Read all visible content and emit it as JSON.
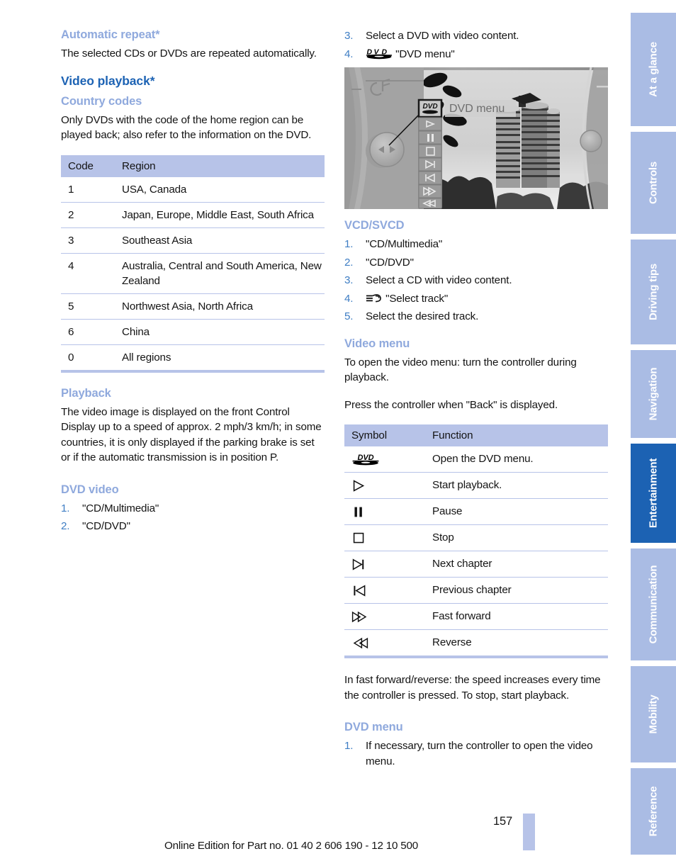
{
  "document": {
    "page_number": "157",
    "edition_notice": "Online Edition for Part no. 01 40 2 606 190 - 12 10 500"
  },
  "sidebar": {
    "tabs": [
      {
        "label": "At a glance",
        "active": false
      },
      {
        "label": "Controls",
        "active": false
      },
      {
        "label": "Driving tips",
        "active": false
      },
      {
        "label": "Navigation",
        "active": false
      },
      {
        "label": "Entertainment",
        "active": true
      },
      {
        "label": "Communication",
        "active": false
      },
      {
        "label": "Mobility",
        "active": false
      },
      {
        "label": "Reference",
        "active": false
      }
    ],
    "colors": {
      "inactive": "#aabce4",
      "active": "#1c62b3",
      "label": "#ffffff"
    }
  },
  "left_column": {
    "automatic_repeat": {
      "heading": "Automatic repeat*",
      "body": "The selected CDs or DVDs are repeated automatically."
    },
    "video_playback": {
      "heading": "Video playback*"
    },
    "country_codes": {
      "heading": "Country codes",
      "body": "Only DVDs with the code of the home region can be played back; also refer to the information on the DVD.",
      "table": {
        "headers": [
          "Code",
          "Region"
        ],
        "rows": [
          [
            "1",
            "USA, Canada"
          ],
          [
            "2",
            "Japan, Europe, Middle East, South Africa"
          ],
          [
            "3",
            "Southeast Asia"
          ],
          [
            "4",
            "Australia, Central and South America, New Zealand"
          ],
          [
            "5",
            "Northwest Asia, North Africa"
          ],
          [
            "6",
            "China"
          ],
          [
            "0",
            "All regions"
          ]
        ]
      }
    },
    "playback": {
      "heading": "Playback",
      "body": "The video image is displayed on the front Control Display up to a speed of approx. 2 mph/3 km/h; in some countries, it is only displayed if the parking brake is set or if the automatic transmission is in position P."
    },
    "dvd_video": {
      "heading": "DVD video",
      "steps": [
        {
          "num": "1.",
          "text": "\"CD/Multimedia\""
        },
        {
          "num": "2.",
          "text": "\"CD/DVD\""
        }
      ]
    }
  },
  "right_column": {
    "dvd_video_continued": {
      "steps": [
        {
          "num": "3.",
          "text": "Select a DVD with video content.",
          "icon": ""
        },
        {
          "num": "4.",
          "text": "\"DVD menu\"",
          "icon": "dvd-logo-icon"
        }
      ]
    },
    "figure": {
      "name": "control-display-dvd-menu-screenshot",
      "tooltip_label": "DVD menu",
      "menu_icons": [
        "dvd-logo-icon",
        "play-icon",
        "pause-icon",
        "stop-icon",
        "next-chapter-icon",
        "previous-chapter-icon",
        "fast-forward-icon",
        "reverse-icon"
      ],
      "top_left_icon": "audio-note-icon"
    },
    "vcd_svcd": {
      "heading": "VCD/SVCD",
      "steps": [
        {
          "num": "1.",
          "text": "\"CD/Multimedia\"",
          "icon": ""
        },
        {
          "num": "2.",
          "text": "\"CD/DVD\"",
          "icon": ""
        },
        {
          "num": "3.",
          "text": "Select a CD with video content.",
          "icon": ""
        },
        {
          "num": "4.",
          "text": "\"Select track\"",
          "icon": "select-track-icon"
        },
        {
          "num": "5.",
          "text": "Select the desired track.",
          "icon": ""
        }
      ]
    },
    "video_menu": {
      "heading": "Video menu",
      "body1": "To open the video menu: turn the controller during playback.",
      "body2": "Press the controller when \"Back\" is displayed.",
      "table": {
        "headers": [
          "Symbol",
          "Function"
        ],
        "rows": [
          {
            "icon": "dvd-logo-icon",
            "function": "Open the DVD menu."
          },
          {
            "icon": "play-icon",
            "function": "Start playback."
          },
          {
            "icon": "pause-icon",
            "function": "Pause"
          },
          {
            "icon": "stop-icon",
            "function": "Stop"
          },
          {
            "icon": "next-chapter-icon",
            "function": "Next chapter"
          },
          {
            "icon": "previous-chapter-icon",
            "function": "Previous chapter"
          },
          {
            "icon": "fast-forward-icon",
            "function": "Fast forward"
          },
          {
            "icon": "reverse-icon",
            "function": "Reverse"
          }
        ]
      },
      "note": "In fast forward/reverse: the speed increases every time the controller is pressed. To stop, start playback."
    },
    "dvd_menu": {
      "heading": "DVD menu",
      "steps": [
        {
          "num": "1.",
          "text": "If necessary, turn the controller to open the video menu."
        }
      ]
    }
  },
  "colors": {
    "heading_level2": "#1d63b4",
    "heading_level3": "#8fa9dd",
    "list_number": "#3f7ec4",
    "table_header_bg": "#b7c3e8",
    "table_rule": "#b7c3e8",
    "body_text": "#141414"
  }
}
